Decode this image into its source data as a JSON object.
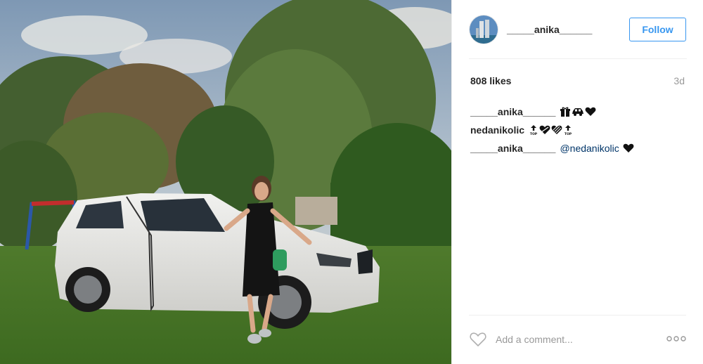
{
  "post": {
    "username": "_____anika______",
    "follow_label": "Follow",
    "likes": "808 likes",
    "age": "3d",
    "comments": [
      {
        "user": "_____anika______",
        "text": "",
        "emojis": [
          "gift-icon",
          "car-icon",
          "heart-icon"
        ]
      },
      {
        "user": "nedanikolic",
        "text": "",
        "emojis": [
          "top-arrow-icon",
          "heart-arrow-icon",
          "heart-striped-icon",
          "top-arrow-icon"
        ]
      },
      {
        "user": "_____anika______",
        "mention": "@nedanikolic",
        "emojis": [
          "heart-icon"
        ]
      }
    ],
    "comment_placeholder": "Add a comment...",
    "colors": {
      "accent": "#3897f0",
      "mention": "#003569",
      "muted": "#999999",
      "divider": "#efefef"
    }
  }
}
